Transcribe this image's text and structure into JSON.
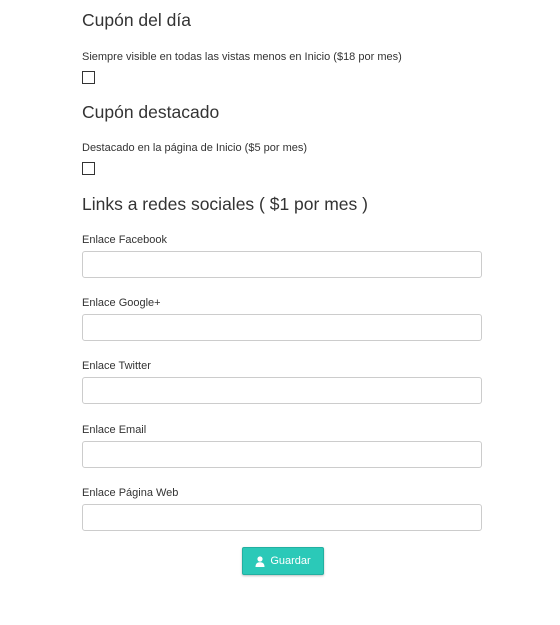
{
  "coupon_day": {
    "title": "Cupón del día",
    "description": "Siempre visible en todas las vistas menos en Inicio ($18 por mes)",
    "checked": false
  },
  "coupon_featured": {
    "title": "Cupón destacado",
    "description": "Destacado en la página de Inicio ($5 por mes)",
    "checked": false
  },
  "social": {
    "title": "Links a redes sociales ( $1 por mes )",
    "fields": [
      {
        "label": "Enlace Facebook",
        "value": "",
        "placeholder": ""
      },
      {
        "label": "Enlace Google+",
        "value": "",
        "placeholder": ""
      },
      {
        "label": "Enlace Twitter",
        "value": "",
        "placeholder": ""
      },
      {
        "label": "Enlace Email",
        "value": "",
        "placeholder": ""
      },
      {
        "label": "Enlace Página Web",
        "value": "",
        "placeholder": ""
      }
    ]
  },
  "save_button": {
    "label": "Guardar",
    "icon": "user-icon",
    "color": "#2bc9b8"
  }
}
